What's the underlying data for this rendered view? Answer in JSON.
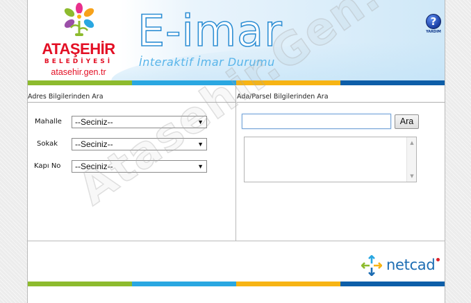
{
  "header": {
    "logo": {
      "name": "ATAŞEHİR",
      "subtitle": "BELEDİYESİ",
      "url": "atasehir.gen.tr"
    },
    "title": "E-imar",
    "subtitle": "İnteraktif İmar Durumu",
    "help_label": "YARDIM",
    "help_glyph": "?"
  },
  "address_panel": {
    "title": "Adres Bilgilerinden Ara",
    "fields": [
      {
        "label": "Mahalle",
        "value": "--Seciniz--"
      },
      {
        "label": "Sokak",
        "value": "--Seciniz--"
      },
      {
        "label": "Kapı No",
        "value": "--Seciniz--"
      }
    ],
    "dropdown_arrow": "▼"
  },
  "parcel_panel": {
    "title": "Ada/Parsel Bilgilerinden Ara",
    "search_value": "",
    "search_button": "Ara",
    "scroll_up": "▲",
    "scroll_down": "▼"
  },
  "footer": {
    "brand": "netcad"
  },
  "watermark": "Atasehir.Gen.tr",
  "colors": {
    "stripe_green": "#8dbb2e",
    "stripe_cyan": "#2aa7e1",
    "stripe_yellow": "#f7b414",
    "stripe_navy": "#0d5ea8",
    "logo_red": "#e30f24",
    "title_blue": "#2f8fd4",
    "netcad_blue": "#1d6db3"
  },
  "icons": {
    "help": "question-mark-icon",
    "logo": "flower-person-icon",
    "netcad": "netcad-arrows-icon"
  }
}
